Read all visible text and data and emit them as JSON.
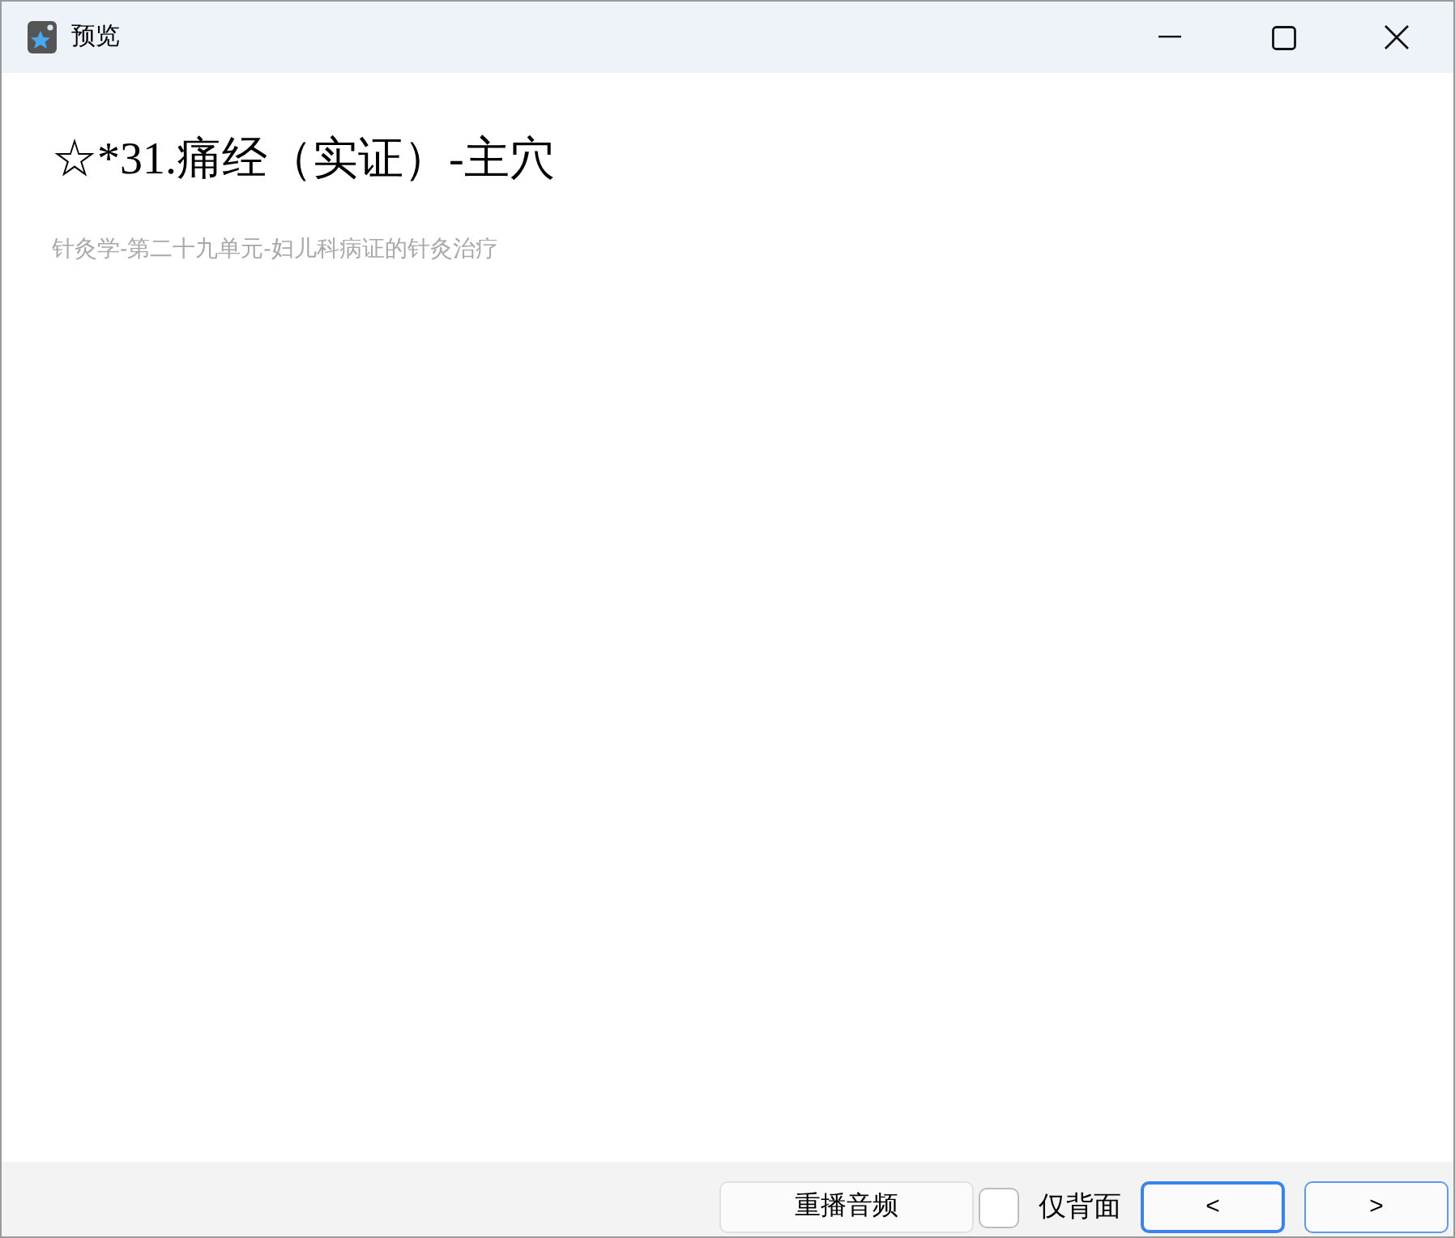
{
  "window": {
    "title": "预览"
  },
  "card": {
    "title": "☆*31.痛经（实证）-主穴",
    "subtitle": "针灸学-第二十九单元-妇儿科病证的针灸治疗"
  },
  "footer": {
    "replay_button": "重播音频",
    "back_only": {
      "label": "仅背面",
      "checked": false
    },
    "nav_buttons": [
      {
        "label": "<",
        "selected": true
      },
      {
        "label": ">",
        "selected": false
      }
    ]
  }
}
